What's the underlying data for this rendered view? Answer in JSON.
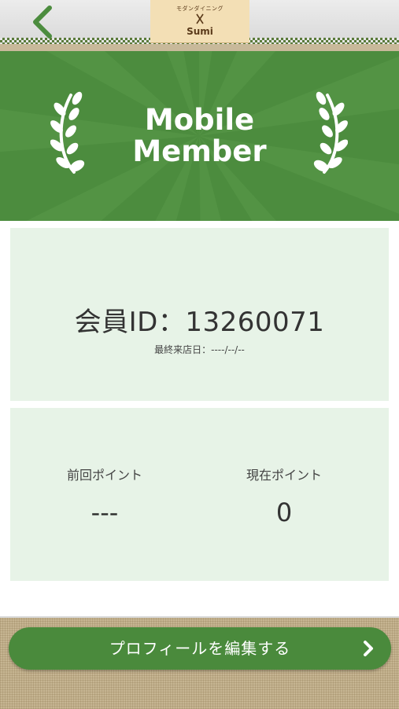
{
  "header": {
    "logo_subtitle": "モダンダイニング",
    "logo_title": "Sumi",
    "back_icon": "chevron-left-icon"
  },
  "banner": {
    "title_line1": "Mobile",
    "title_line2": "Member",
    "left_decoration": "laurel-icon",
    "right_decoration": "laurel-icon"
  },
  "member": {
    "id_text": "会員ID：13260071",
    "last_visit": "最終来店日：----/--/--"
  },
  "points": {
    "previous_label": "前回ポイント",
    "previous_value": "---",
    "current_label": "現在ポイント",
    "current_value": "0"
  },
  "footer": {
    "profile_button_label": "プロフィールを編集する",
    "profile_button_icon": "chevron-right-icon"
  },
  "colors": {
    "brand_green": "#4c8c3e",
    "card_bg": "#e7f3e7",
    "button_green": "#4a8a3c"
  }
}
